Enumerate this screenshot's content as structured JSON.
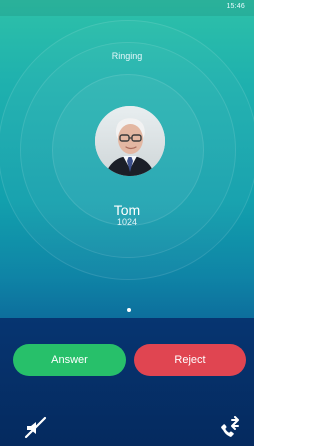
{
  "status_bar": {
    "time": "15:46"
  },
  "call": {
    "state": "Ringing",
    "caller_name": "Tom",
    "caller_number": "1024"
  },
  "actions": {
    "answer_label": "Answer",
    "reject_label": "Reject",
    "answer_color": "#27c06a",
    "reject_color": "#e04551"
  },
  "icons": {
    "left": "mute-icon",
    "right": "transfer-icon",
    "avatar": "caller-avatar"
  }
}
